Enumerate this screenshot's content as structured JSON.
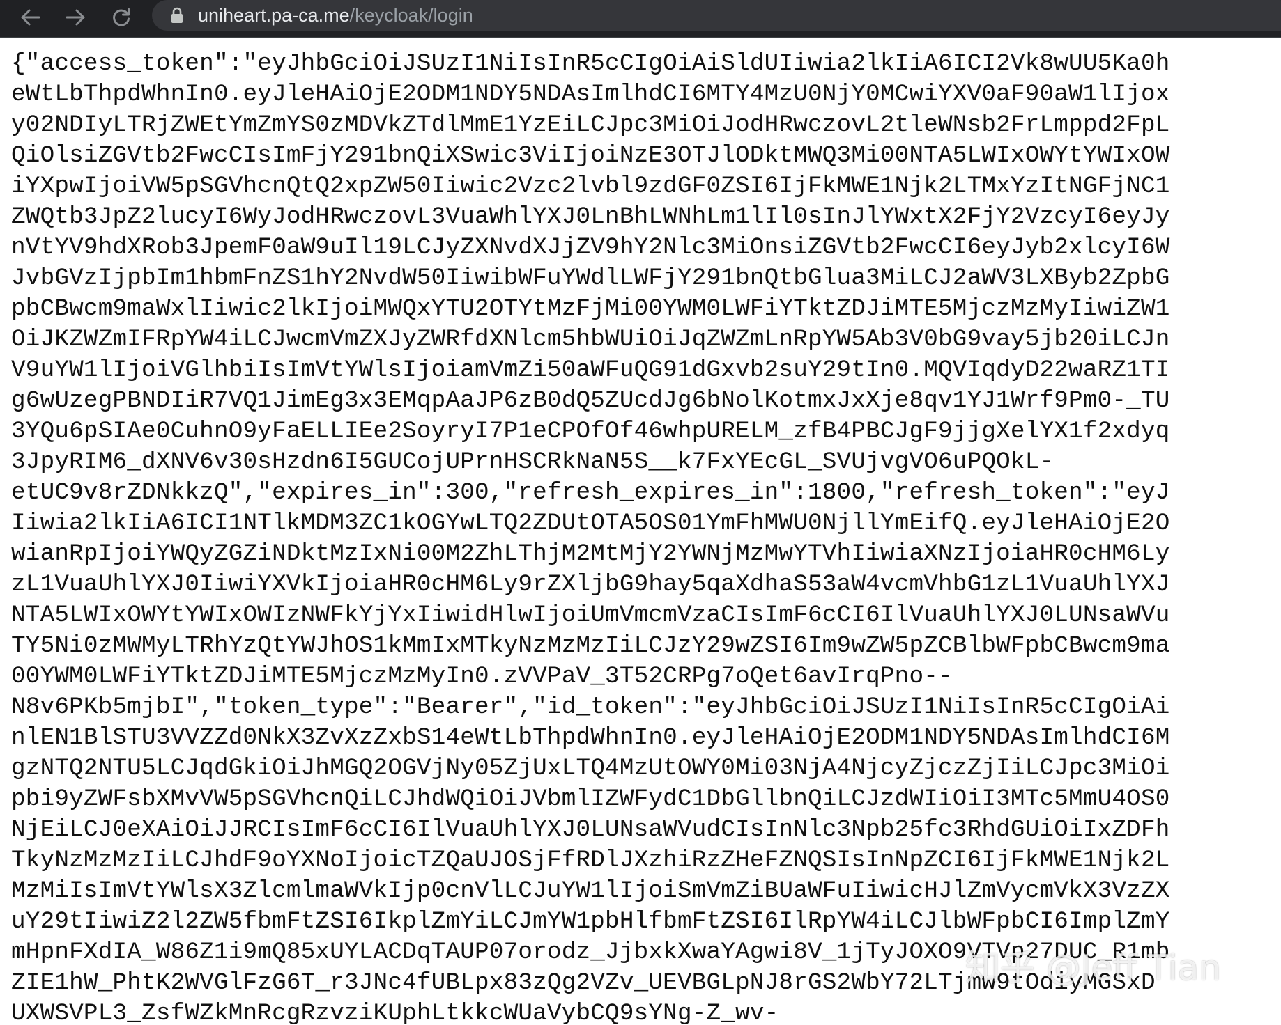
{
  "browser": {
    "url_host": "uniheart.pa-ca.me",
    "url_path": "/keycloak/login",
    "icons": {
      "back": "arrow-left-icon",
      "forward": "arrow-right-icon",
      "reload": "reload-icon",
      "security": "lock-icon"
    }
  },
  "page": {
    "lines": [
      "{\"access_token\":\"eyJhbGciOiJSUzI1NiIsInR5cCIgOiAiSldUIiwia2lkIiA6ICI2Vk8wUU5Ka0h",
      "eWtLbThpdWhnIn0.eyJleHAiOjE2ODM1NDY5NDAsImlhdCI6MTY4MzU0NjY0MCwiYXV0aF90aW1lIjox",
      "y02NDIyLTRjZWEtYmZmYS0zMDVkZTdlMmE1YzEiLCJpc3MiOiJodHRwczovL2tleWNsb2FrLmppd2FpL",
      "QiOlsiZGVtb2FwcCIsImFjY291bnQiXSwic3ViIjoiNzE3OTJlODktMWQ3Mi00NTA5LWIxOWYtYWIxOW",
      "iYXpwIjoiVW5pSGVhcnQtQ2xpZW50Iiwic2Vzc2lvbl9zdGF0ZSI6IjFkMWE1Njk2LTMxYzItNGFjNC1",
      "ZWQtb3JpZ2lucyI6WyJodHRwczovL3VuaWhlYXJ0LnBhLWNhLm1lIl0sInJlYWxtX2FjY2VzcyI6eyJy",
      "nVtYV9hdXRob3JpemF0aW9uIl19LCJyZXNvdXJjZV9hY2Nlc3MiOnsiZGVtb2FwcCI6eyJyb2xlcyI6W",
      "JvbGVzIjpbIm1hbmFnZS1hY2NvdW50IiwibWFuYWdlLWFjY291bnQtbGlua3MiLCJ2aWV3LXByb2ZpbG",
      "pbCBwcm9maWxlIiwic2lkIjoiMWQxYTU2OTYtMzFjMi00YWM0LWFiYTktZDJiMTE5MjczMzMyIiwiZW1",
      "OiJKZWZmIFRpYW4iLCJwcmVmZXJyZWRfdXNlcm5hbWUiOiJqZWZmLnRpYW5Ab3V0bG9vay5jb20iLCJn",
      "V9uYW1lIjoiVGlhbiIsImVtYWlsIjoiamVmZi50aWFuQG91dGxvb2suY29tIn0.MQVIqdyD22waRZ1TI",
      "g6wUzegPBNDIiR7VQ1JimEg3x3EMqpAaJP6zB0dQ5ZUcdJg6bNolKotmxJxXje8qv1YJ1Wrf9Pm0-_TU",
      "3YQu6pSIAe0CuhnO9yFaELLIEe2SoyryI7P1eCPOfOf46whpURELM_zfB4PBCJgF9jjgXelYX1f2xdyq",
      "3JpyRIM6_dXNV6v30sHzdn6I5GUCojUPrnHSCRkNaN5S__k7FxYEcGL_SVUjvgVO6uPQOkL-",
      "etUC9v8rZDNkkzQ\",\"expires_in\":300,\"refresh_expires_in\":1800,\"refresh_token\":\"eyJ",
      "Iiwia2lkIiA6ICI1NTlkMDM3ZC1kOGYwLTQ2ZDUtOTA5OS01YmFhMWU0NjllYmEifQ.eyJleHAiOjE2O",
      "wianRpIjoiYWQyZGZiNDktMzIxNi00M2ZhLThjM2MtMjY2YWNjMzMwYTVhIiwiaXNzIjoiaHR0cHM6Ly",
      "zL1VuaUhlYXJ0IiwiYXVkIjoiaHR0cHM6Ly9rZXljbG9hay5qaXdhaS53aW4vcmVhbG1zL1VuaUhlYXJ",
      "NTA5LWIxOWYtYWIxOWIzNWFkYjYxIiwidHlwIjoiUmVmcmVzaCIsImF6cCI6IlVuaUhlYXJ0LUNsaWVu",
      "TY5Ni0zMWMyLTRhYzQtYWJhOS1kMmIxMTkyNzMzMzIiLCJzY29wZSI6Im9wZW5pZCBlbWFpbCBwcm9ma",
      "00YWM0LWFiYTktZDJiMTE5MjczMzMyIn0.zVVPaV_3T52CRPg7oQet6avIrqPno--",
      "N8v6PKb5mjbI\",\"token_type\":\"Bearer\",\"id_token\":\"eyJhbGciOiJSUzI1NiIsInR5cCIgOiAi",
      "nlEN1BlSTU3VVZZd0NkX3ZvXzZxbS14eWtLbThpdWhnIn0.eyJleHAiOjE2ODM1NDY5NDAsImlhdCI6M",
      "gzNTQ2NTU5LCJqdGkiOiJhMGQ2OGVjNy05ZjUxLTQ4MzUtOWY0Mi03NjA4NjcyZjczZjIiLCJpc3MiOi",
      "pbi9yZWFsbXMvVW5pSGVhcnQiLCJhdWQiOiJVbmlIZWFydC1DbGllbnQiLCJzdWIiOiI3MTc5MmU4OS0",
      "NjEiLCJ0eXAiOiJJRCIsImF6cCI6IlVuaUhlYXJ0LUNsaWVudCIsInNlc3Npb25fc3RhdGUiOiIxZDFh",
      "TkyNzMzMzIiLCJhdF9oYXNoIjoicTZQaUJOSjFfRDlJXzhiRzZHeFZNQSIsInNpZCI6IjFkMWE1Njk2L",
      "MzMiIsImVtYWlsX3ZlcmlmaWVkIjp0cnVlLCJuYW1lIjoiSmVmZiBUaWFuIiwicHJlZmVycmVkX3VzZX",
      "uY29tIiwiZ2l2ZW5fbmFtZSI6IkplZmYiLCJmYW1pbHlfbmFtZSI6IlRpYW4iLCJlbWFpbCI6ImplZmY",
      "mHpnFXdIA_W86Z1i9mQ85xUYLACDqTAUP07orodz_JjbxkXwaYAgwi8V_1jTyJOXO9VTVp27DUC_R1mb",
      "ZIE1hW_PhtK2WVGlFzG6T_r3JNc4fUBLpx83zQg2VZv_UEVBGLpNJ8rGS2WbY72LTjmw9tOdiyMGSxD",
      "UXWSVPL3_ZsfWZkMnRcgRzvziKUphLtkkcWUaVybCQ9sYNg-Z_wv-"
    ]
  },
  "watermark": "知乎 @Jeff Tian"
}
